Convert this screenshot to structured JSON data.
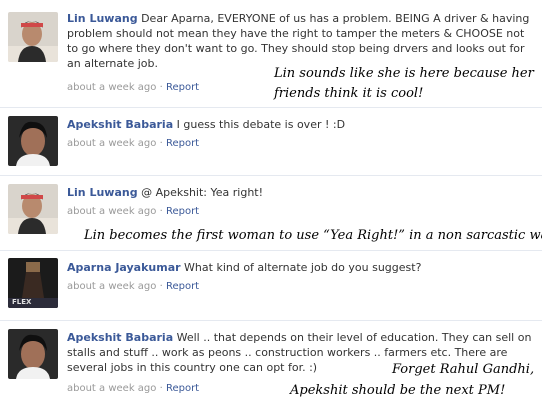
{
  "comments": [
    {
      "author": "Lin Luwang",
      "text": "Dear Aparna, EVERYONE of us has a problem. BEING A driver & having problem should not mean they have the right to tamper the meters & CHOOSE not to go where they don't want to go. They should stop being drvers and looks out for an alternate job.",
      "time": "about a week ago",
      "separator": "·",
      "report": "Report"
    },
    {
      "author": "Apekshit Babaria",
      "text": "I guess this debate is over ! :D",
      "time": "about a week ago",
      "separator": "·",
      "report": "Report"
    },
    {
      "author": "Lin Luwang",
      "text": "@ Apekshit: Yea right!",
      "time": "about a week ago",
      "separator": "·",
      "report": "Report"
    },
    {
      "author": "Aparna Jayakumar",
      "text": "What kind of alternate job do you suggest?",
      "time": "about a week ago",
      "separator": "·",
      "report": "Report"
    },
    {
      "author": "Apekshit Babaria",
      "text": "Well .. that depends on their level of education. They can sell on stalls and stuff .. work as peons .. construction workers .. farmers etc. There are several jobs in this country one can opt for. :)",
      "time": "about a week ago",
      "separator": "·",
      "report": "Report"
    }
  ],
  "annotations": {
    "a1_line1": "Lin sounds like she is here because her",
    "a1_line2": "friends think it is cool!",
    "a2": "Lin becomes the first woman to use “Yea Right!” in a non sarcastic way",
    "a3_line1": "Forget Rahul Gandhi,",
    "a3_line2": "Apekshit should be the next PM!"
  },
  "avatar_badge": "FLEX",
  "colors": {
    "author_link": "#3b5998",
    "body_text": "#333333",
    "meta_text": "#999999",
    "divider": "#e5e9f0"
  }
}
